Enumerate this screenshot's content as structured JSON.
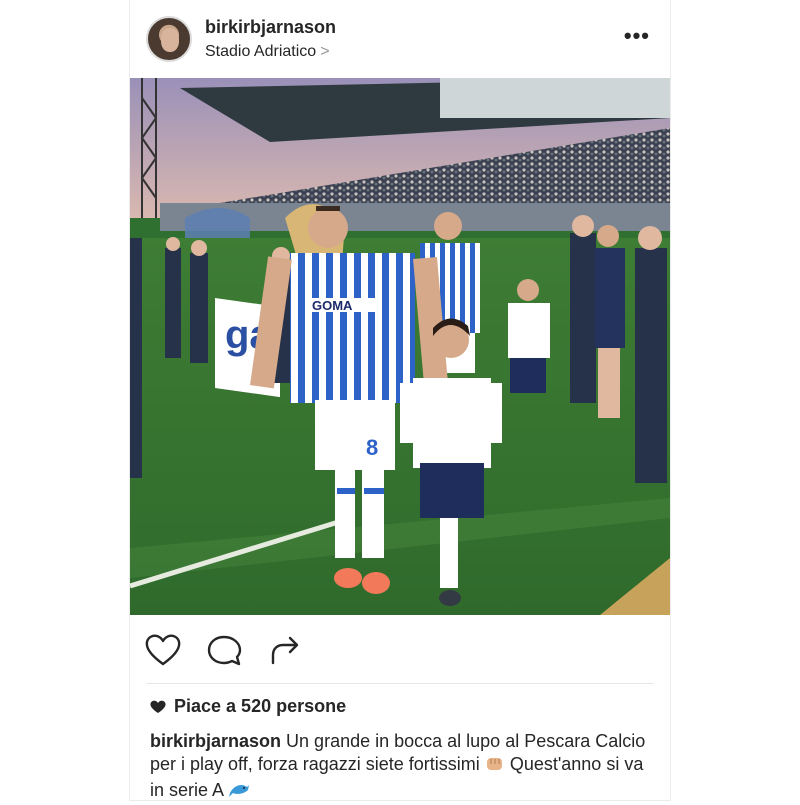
{
  "post": {
    "username": "birkirbjarnason",
    "location": "Stadio Adriatico",
    "location_chevron": ">",
    "more_menu": "•••"
  },
  "photo": {
    "description_alt": "",
    "shirt_number": "8",
    "sponsor_text": "gai"
  },
  "actions": {
    "like_icon": "heart-icon",
    "comment_icon": "comment-icon",
    "share_icon": "share-icon"
  },
  "likes": {
    "text": "Piace a 520 persone"
  },
  "caption": {
    "username": "birkirbjarnason",
    "text_part1": "Un grande in bocca al lupo al Pescara Calcio per i play off, forza ragazzi siete fortissimi",
    "text_part2": " Quest'anno si va in serie A"
  },
  "colors": {
    "text": "#262626",
    "secondary": "#999999",
    "kit_blue": "#2d62c8",
    "pitch": "#3f8a36"
  }
}
